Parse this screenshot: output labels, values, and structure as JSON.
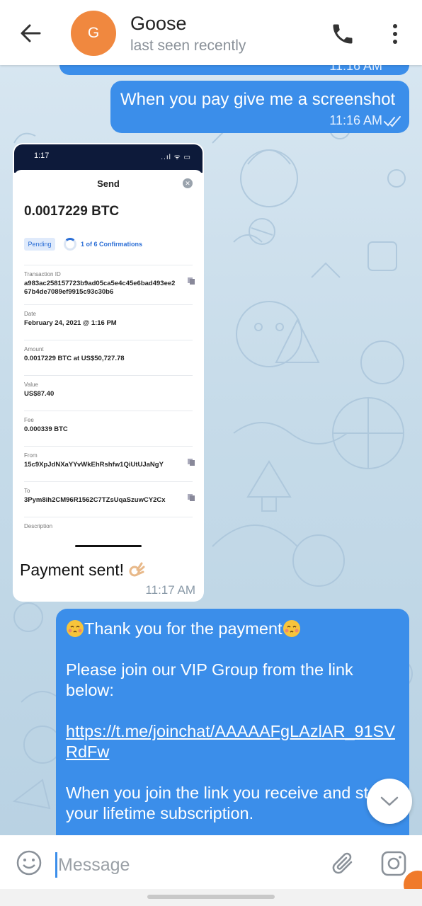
{
  "header": {
    "avatar_letter": "G",
    "contact_name": "Goose",
    "status": "last seen recently"
  },
  "messages": {
    "previous_time": "11:16 AM",
    "screenshot_request": {
      "text": "When you pay give me a screenshot",
      "time": "11:16 AM"
    },
    "payment_screenshot": {
      "phone_time": "1:17",
      "phone_signal": "..ıl ᯤ ▭",
      "sheet_title": "Send",
      "amount": "0.0017229 BTC",
      "status_badge": "Pending",
      "confirmations": "1 of 6 Confirmations",
      "fields": [
        {
          "label": "Transaction ID",
          "value": "a983ac258157723b9ad05ca5e4c45e6bad493ee267b4de7089ef9915c93c30b6"
        },
        {
          "label": "Date",
          "value": "February 24, 2021 @ 1:16 PM"
        },
        {
          "label": "Amount",
          "value": "0.0017229 BTC at US$50,727.78"
        },
        {
          "label": "Value",
          "value": "US$87.40"
        },
        {
          "label": "Fee",
          "value": "0.000339 BTC"
        },
        {
          "label": "From",
          "value": "15c9XpJdNXaYYvWkEhRshfw1QiUtUJaNgY"
        },
        {
          "label": "To",
          "value": "3Pym8ih2CM96R1562C7TZsUqaSzuwCY2Cx"
        },
        {
          "label": "Description",
          "value": ""
        }
      ],
      "caption": "Payment sent!",
      "time": "11:17 AM"
    },
    "vip_message": {
      "thanks": "Thank you for the payment",
      "join_text": "Please join our VIP Group from the link below:",
      "link": "https://t.me/joinchat/AAAAAFgLAzlAR_91SVRdFw",
      "lifetime_text": "When you join the link you receive and start your lifetime subscription."
    }
  },
  "input": {
    "placeholder": "Message"
  },
  "colors": {
    "accent": "#3b8eea",
    "avatar": "#f0883f",
    "header_bg": "#ffffff"
  }
}
